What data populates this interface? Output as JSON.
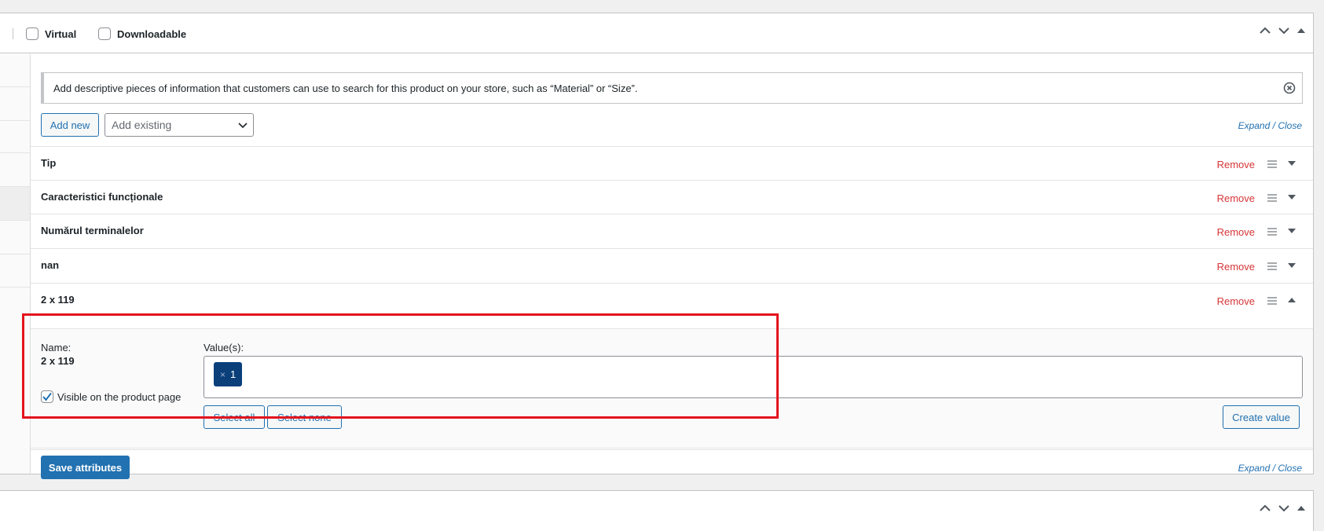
{
  "header": {
    "virtual_label": "Virtual",
    "downloadable_label": "Downloadable"
  },
  "notice": {
    "text": "Add descriptive pieces of information that customers can use to search for this product on your store, such as “Material” or “Size”."
  },
  "toolbar": {
    "add_new_label": "Add new",
    "add_existing_placeholder": "Add existing",
    "expand_label": "Expand",
    "link_separator": "/",
    "close_label": "Close"
  },
  "attributes": [
    {
      "name": "Tip",
      "remove_label": "Remove"
    },
    {
      "name": "Caracteristici funcționale",
      "remove_label": "Remove"
    },
    {
      "name": "Numărul terminalelor",
      "remove_label": "Remove"
    },
    {
      "name": "nan",
      "remove_label": "Remove"
    },
    {
      "name": "2 x 119",
      "remove_label": "Remove"
    }
  ],
  "expanded_attribute": {
    "name_label": "Name:",
    "name_value": "2 x 119",
    "values_label": "Value(s):",
    "token_remove": "×",
    "selected_values": [
      "1"
    ],
    "visible_label": "Visible on the product page",
    "visible_checked": true,
    "select_all_label": "Select all",
    "select_none_label": "Select none",
    "create_value_label": "Create value"
  },
  "footer": {
    "save_label": "Save attributes",
    "expand_label": "Expand",
    "link_separator": "/",
    "close_label": "Close"
  },
  "colors": {
    "accent": "#2271b1",
    "remove": "#d63638",
    "highlight": "#e3141c",
    "token_bg": "#0a3f7a"
  }
}
